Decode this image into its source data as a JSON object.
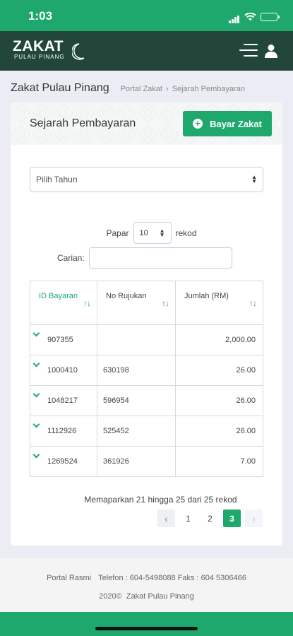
{
  "status_bar": {
    "time": "1:03"
  },
  "brand": {
    "logo_main": "ZAKAT",
    "logo_sub": "PULAU PINANG",
    "primary_color": "#1fa86e",
    "nav_color": "#22473a"
  },
  "header": {
    "menu_icon": "hamburger-menu-icon",
    "user_icon": "user-icon"
  },
  "page": {
    "title": "Zakat Pulau Pinang",
    "breadcrumb": [
      "Portal Zakat",
      "Sejarah Pembayaran"
    ],
    "breadcrumb_sep": "›"
  },
  "card": {
    "title": "Sejarah Pembayaran",
    "pay_button": "Bayar Zakat",
    "year_select_placeholder": "Pilih Tahun",
    "show_label": "Papar",
    "page_length": "10",
    "records_label": "rekod",
    "search_label": "Carian:",
    "search_value": ""
  },
  "table": {
    "columns": [
      {
        "label": "ID Bayaran",
        "sort": "↑↓"
      },
      {
        "label": "No Rujukan",
        "sort": "↑↓"
      },
      {
        "label": "Jumlah (RM)",
        "sort": "↑↓"
      }
    ],
    "rows": [
      [
        "907355",
        "",
        "2,000.00"
      ],
      [
        "1000410",
        "630198",
        "26.00"
      ],
      [
        "1048217",
        "596954",
        "26.00"
      ],
      [
        "1112926",
        "525452",
        "26.00"
      ],
      [
        "1269524",
        "361926",
        "7.00"
      ]
    ]
  },
  "pagination": {
    "info": "Memaparkan 21 hingga 25 dari 25 rekod",
    "prev": "‹",
    "next": "›",
    "pages": [
      "1",
      "2",
      "3"
    ],
    "current": "3"
  },
  "footer": {
    "portal": "Portal Rasmi",
    "contact": "Telefon : 604-5498088 Faks : 604 5306466",
    "copyright": "2020©",
    "org": "Zakat Pulau Pinang"
  }
}
